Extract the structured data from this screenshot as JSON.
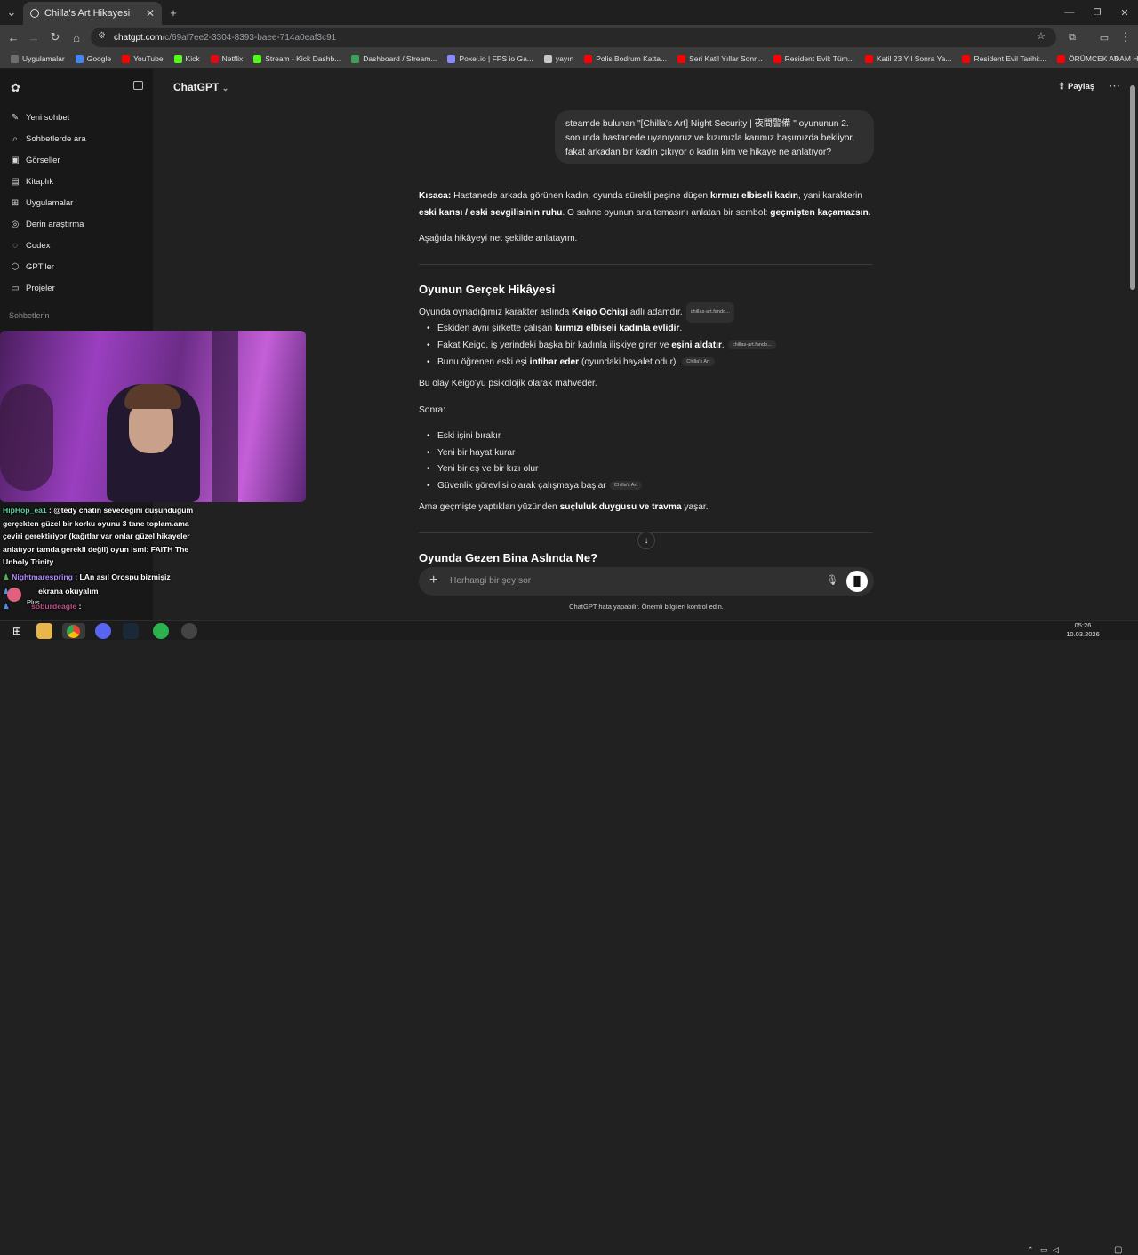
{
  "browser": {
    "tab_title": "Chilla's Art Hikayesi",
    "url_host": "chatgpt.com",
    "url_path": "/c/69af7ee2-3304-8393-baee-714a0eaf3c91",
    "bookmarks": [
      {
        "label": "Uygulamalar",
        "color": "#6f6f6f"
      },
      {
        "label": "Google",
        "color": "#4285f4"
      },
      {
        "label": "YouTube",
        "color": "#ff0000"
      },
      {
        "label": "Kick",
        "color": "#53fc18"
      },
      {
        "label": "Netflix",
        "color": "#e50914"
      },
      {
        "label": "Stream - Kick Dashb...",
        "color": "#53fc18"
      },
      {
        "label": "Dashboard / Stream...",
        "color": "#3fa05a"
      },
      {
        "label": "Poxel.io | FPS io Ga...",
        "color": "#8a8aff"
      },
      {
        "label": "yayın",
        "color": "#c8c8c8"
      },
      {
        "label": "Polis Bodrum Katta...",
        "color": "#ff0000"
      },
      {
        "label": "Seri Katil Yıllar Sonr...",
        "color": "#ff0000"
      },
      {
        "label": "Resident Evil: Tüm...",
        "color": "#ff0000"
      },
      {
        "label": "Katil 23 Yıl Sonra Ya...",
        "color": "#ff0000"
      },
      {
        "label": "Resident Evil Tarihi:...",
        "color": "#ff0000"
      },
      {
        "label": "ÖRÜMCEK ADAM H...",
        "color": "#ff0000"
      }
    ]
  },
  "sidebar": {
    "items": [
      {
        "label": "Yeni sohbet",
        "icon": "✎"
      },
      {
        "label": "Sohbetlerde ara",
        "icon": "⌕"
      },
      {
        "label": "Görseller",
        "icon": "▣"
      },
      {
        "label": "Kitaplık",
        "icon": "▤"
      },
      {
        "label": "Uygulamalar",
        "icon": "⊞"
      },
      {
        "label": "Derin araştırma",
        "icon": "◎"
      },
      {
        "label": "Codex",
        "icon": "◌"
      },
      {
        "label": "GPT'ler",
        "icon": "⬡"
      },
      {
        "label": "Projeler",
        "icon": "▭"
      }
    ],
    "section_label": "Sohbetlerin"
  },
  "header": {
    "model": "ChatGPT",
    "share": "Paylaş"
  },
  "conversation": {
    "user_message": "steamde bulunan \"[Chilla's Art] Night Security | 夜間警備 \" oyununun 2. sonunda hastanede uyanıyoruz ve kızımızla karımız başımızda bekliyor, fakat arkadan bir kadın çıkıyor o kadın kim ve hikaye ne anlatıyor?",
    "summary_1a": "Kısaca:",
    "summary_1b": " Hastanede arkada görünen kadın, oyunda sürekli peşine düşen ",
    "summary_1c": "kırmızı elbiseli kadın",
    "summary_1d": ", yani karakterin ",
    "summary_1e": "eski karısı / eski sevgilisinin ruhu",
    "summary_1f": ". O sahne oyunun ana temasını anlatan bir sembol: ",
    "summary_1g": "geçmişten kaçamazsın.",
    "intro": "Aşağıda hikâyeyi net şekilde anlatayım.",
    "section1_title": "Oyunun Gerçek Hikâyesi",
    "s1_p_a": "Oyunda oynadığımız karakter aslında ",
    "s1_p_b": "Keigo Ochigi",
    "s1_p_c": " adlı adamdır.",
    "s1_p_chip": "chillas-art.fando...",
    "b1_a": "Eskiden aynı şirkette çalışan ",
    "b1_b": "kırmızı elbiseli kadınla evlidir",
    "b1_c": ".",
    "b2_a": "Fakat Keigo, iş yerindeki başka bir kadınla ilişkiye girer ve ",
    "b2_b": "eşini aldatır",
    "b2_c": ".",
    "b2_chip": "chillas-art.fando...",
    "b3_a": "Bunu öğrenen eski eşi ",
    "b3_b": "intihar eder",
    "b3_c": " (oyundaki hayalet odur).",
    "b3_chip": "Chilla's Art",
    "p_destroy": "Bu olay Keigo'yu psikolojik olarak mahveder.",
    "p_then": "Sonra:",
    "then_items": [
      "Eski işini bırakır",
      "Yeni bir hayat kurar",
      "Yeni bir eş ve bir kızı olur",
      "Güvenlik görevlisi olarak çalışmaya başlar"
    ],
    "then_chip": "Chilla's Art",
    "p_guilt_a": "Ama geçmişte yaptıkları yüzünden ",
    "p_guilt_b": "suçluluk duygusu ve travma",
    "p_guilt_c": " yaşar.",
    "section2_title": "Oyunda Gezen Bina Aslında Ne?"
  },
  "composer": {
    "placeholder": "Herhangi bir şey sor",
    "disclaimer": "ChatGPT hata yapabilir. Önemli bilgileri kontrol edin."
  },
  "stream_chat": {
    "m1_user": "HipHop_ea1",
    "m1_text": " : @tedy chatin seveceğini düşündüğüm gerçekten güzel bir korku oyunu 3 tane toplam.ama çeviri gerektiriyor (kağıtlar var onlar güzel hikayeler anlatıyor tamda gerekli değil) oyun ismi: FAITH The Unholy Trinity",
    "m2_user": "Nightmarespring",
    "m2_text": " : LAn asıl Orospu bizmişiz",
    "m3_text": "ekrana okuyalım",
    "m4_user": "soburdeagle",
    "m4_text": " : ",
    "plus_label": "Plus"
  },
  "taskbar": {
    "time": "05:26",
    "date": "10.03.2026"
  }
}
